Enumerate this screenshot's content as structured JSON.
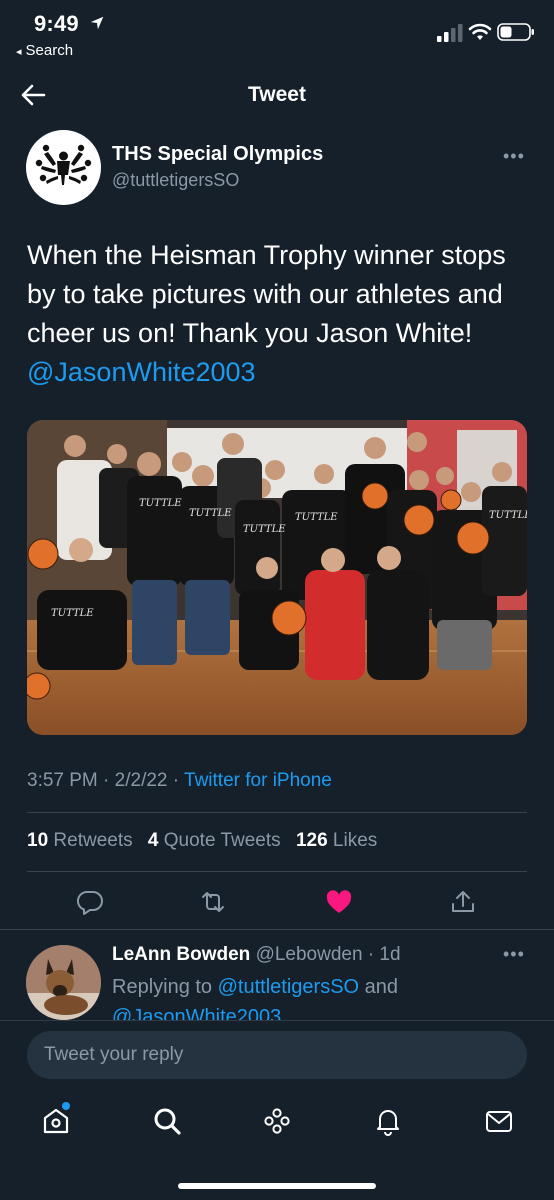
{
  "status_bar": {
    "time": "9:49",
    "back_app": "Search",
    "back_app_arrow": "◂"
  },
  "nav": {
    "title": "Tweet",
    "back_icon": "back-arrow-icon"
  },
  "tweet": {
    "author_name": "THS Special Olympics",
    "author_handle": "@tuttletigersSO",
    "more_icon": "•••",
    "text": "When the Heisman Trophy winner stops by to take pictures with our athletes and cheer us on!  Thank you Jason White! ",
    "mention": "@JasonWhite2003",
    "photo_alt": "Group photo of athletes in black TUTTLE shirts holding basketballs on a gym floor",
    "time": "3:57 PM",
    "date": "2/2/22",
    "separator": "·",
    "source": "Twitter for iPhone",
    "retweets_count": "10",
    "retweets_label": "Retweets",
    "quotes_count": "4",
    "quotes_label": "Quote Tweets",
    "likes_count": "126",
    "likes_label": "Likes",
    "liked": true,
    "like_color": "#f91880"
  },
  "reply": {
    "name": "LeAnn Bowden",
    "handle": "@Lebowden",
    "age": "· 1d",
    "more_icon": "•••",
    "replying_prefix": "Replying to ",
    "replying_to_1": "@tuttletigersSO",
    "replying_and": " and",
    "replying_to_2": "@JasonWhite2003"
  },
  "composer": {
    "placeholder": "Tweet your reply"
  },
  "tabbar": {
    "items": [
      "home-icon",
      "search-icon",
      "spaces-icon",
      "notifications-icon",
      "messages-icon"
    ],
    "home_has_dot": true
  },
  "colors": {
    "background": "#15202b",
    "accent": "#1d9bf0",
    "secondary_text": "#8b98a5",
    "divider": "#38444d"
  }
}
